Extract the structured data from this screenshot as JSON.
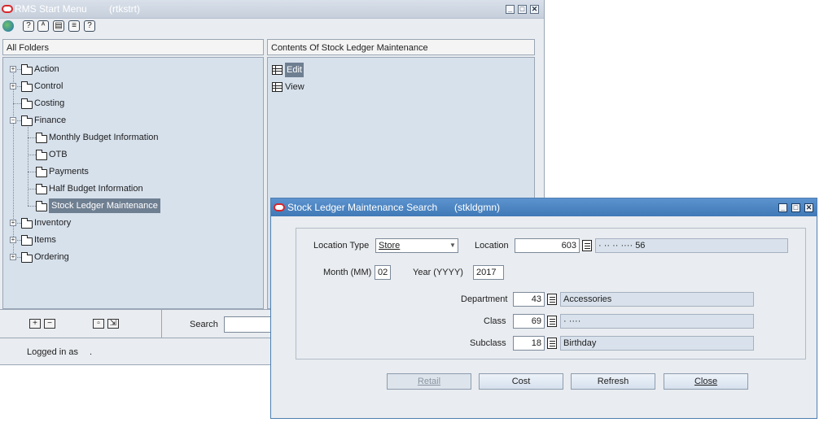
{
  "start_menu": {
    "title": "RMS Start Menu",
    "form_code": "(rtkstrt)",
    "toolbar_icons": [
      "globe-icon",
      "help-icon",
      "find-icon",
      "print-icon",
      "notes-icon",
      "info-icon"
    ],
    "left_panel_title": "All Folders",
    "right_panel_title": "Contents Of Stock Ledger Maintenance",
    "tree": [
      {
        "label": "Action",
        "level": 0,
        "expander": "+"
      },
      {
        "label": "Control",
        "level": 0,
        "expander": "+"
      },
      {
        "label": "Costing",
        "level": 0,
        "expander": ""
      },
      {
        "label": "Finance",
        "level": 0,
        "expander": "-"
      },
      {
        "label": "Monthly Budget Information",
        "level": 1,
        "expander": ""
      },
      {
        "label": "OTB",
        "level": 1,
        "expander": ""
      },
      {
        "label": "Payments",
        "level": 1,
        "expander": ""
      },
      {
        "label": "Half Budget Information",
        "level": 1,
        "expander": ""
      },
      {
        "label": "Stock Ledger Maintenance",
        "level": 1,
        "expander": "",
        "selected": true
      },
      {
        "label": "Inventory",
        "level": 0,
        "expander": "+"
      },
      {
        "label": "Items",
        "level": 0,
        "expander": "+"
      },
      {
        "label": "Ordering",
        "level": 0,
        "expander": "+"
      }
    ],
    "contents": [
      {
        "label": "Edit",
        "selected": true
      },
      {
        "label": "View",
        "selected": false
      }
    ],
    "search_label": "Search",
    "logged_in_label": "Logged in as",
    "logged_in_value": "."
  },
  "search_window": {
    "title": "Stock Ledger Maintenance Search",
    "form_code": "(stkldgmn)",
    "location_type_label": "Location Type",
    "location_type_value": "Store",
    "location_label": "Location",
    "location_value": "603",
    "location_desc": "· ·· ·· ···· 56",
    "month_label": "Month (MM)",
    "month_value": "02",
    "year_label": "Year (YYYY)",
    "year_value": "2017",
    "department_label": "Department",
    "department_value": "43",
    "department_desc": "Accessories",
    "class_label": "Class",
    "class_value": "69",
    "class_desc": "· ····",
    "subclass_label": "Subclass",
    "subclass_value": "18",
    "subclass_desc": "Birthday",
    "buttons": {
      "retail": "Retail",
      "cost": "Cost",
      "refresh": "Refresh",
      "close": "Close"
    }
  }
}
